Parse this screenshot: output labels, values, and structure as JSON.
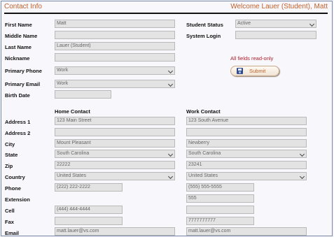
{
  "header": {
    "title": "Contact Info",
    "welcome": "Welcome Lauer (Student), Matt"
  },
  "labels": {
    "first_name": "First Name",
    "middle_name": "Middle Name",
    "last_name": "Last Name",
    "nickname": "Nickname",
    "primary_phone": "Primary Phone",
    "primary_email": "Primary Email",
    "birth_date": "Birth Date",
    "student_status": "Student Status",
    "system_login": "System Login",
    "address1": "Address 1",
    "address2": "Address 2",
    "city": "City",
    "state": "State",
    "zip": "Zip",
    "country": "Country",
    "phone": "Phone",
    "extension": "Extension",
    "cell": "Cell",
    "fax": "Fax",
    "email": "Email"
  },
  "fields": {
    "first_name": "Matt",
    "middle_name": "",
    "last_name": "Lauer (Student)",
    "nickname": "",
    "primary_phone": "Work",
    "primary_email": "Work",
    "birth_date": "",
    "student_status": "Active",
    "system_login": ""
  },
  "note": "All fields read-only",
  "submit_label": "Submit",
  "home": {
    "heading": "Home Contact",
    "address1": "123 Main Street",
    "address2": "",
    "city": "Mount Pleasant",
    "state": "South Carolina",
    "zip": "22222",
    "country": "United States",
    "phone": "(222) 222-2222",
    "cell": "(444) 444-4444",
    "fax": "",
    "email": "matt.lauer@vs.com"
  },
  "work": {
    "heading": "Work Contact",
    "address1": "123 South Avenue",
    "address2": "",
    "city": "Newberry",
    "state": "South Carolina",
    "zip": "23241",
    "country": "United States",
    "phone": "(555) 555-5555",
    "extension": "555",
    "cell": "",
    "fax": "7777777777",
    "email": "matt.lauer@vs.com"
  }
}
